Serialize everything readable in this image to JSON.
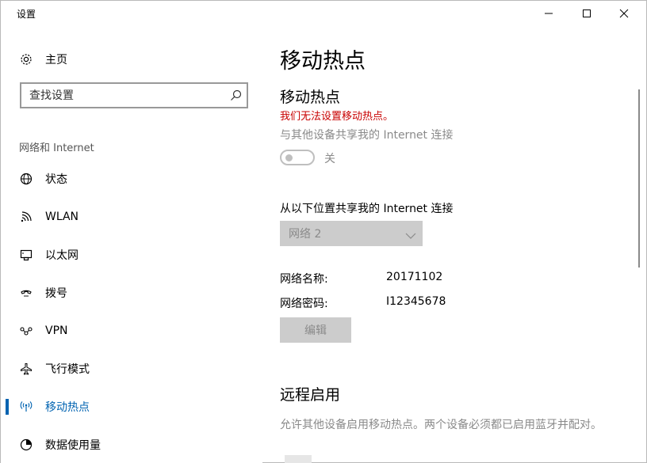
{
  "window": {
    "title": "设置",
    "minimize_label": "Minimize",
    "maximize_label": "Maximize",
    "close_label": "Close"
  },
  "sidebar": {
    "home_label": "主页",
    "search_placeholder": "查找设置",
    "section_label": "网络和 Internet",
    "items": [
      {
        "label": "状态",
        "icon": "globe-icon",
        "active": false
      },
      {
        "label": "WLAN",
        "icon": "wifi-icon",
        "active": false
      },
      {
        "label": "以太网",
        "icon": "ethernet-icon",
        "active": false
      },
      {
        "label": "拨号",
        "icon": "dialup-icon",
        "active": false
      },
      {
        "label": "VPN",
        "icon": "vpn-icon",
        "active": false
      },
      {
        "label": "飞行模式",
        "icon": "airplane-icon",
        "active": false
      },
      {
        "label": "移动热点",
        "icon": "hotspot-icon",
        "active": true
      },
      {
        "label": "数据使用量",
        "icon": "pie-chart-icon",
        "active": false
      }
    ]
  },
  "main": {
    "page_title": "移动热点",
    "section_title": "移动热点",
    "error_text": "我们无法设置移动热点。",
    "share_text": "与其他设备共享我的 Internet 连接",
    "toggle_state": "关",
    "share_from_label": "从以下位置共享我的 Internet 连接",
    "share_from_value": "网络  2",
    "network_name_label": "网络名称:",
    "network_name_value": "20171102",
    "network_password_label": "网络密码:",
    "network_password_value": "I12345678",
    "edit_button": "编辑",
    "remote_title": "远程启用",
    "remote_desc": "允许其他设备启用移动热点。两个设备必须都已启用蓝牙并配对。"
  },
  "colors": {
    "accent": "#0063b1",
    "error": "#c80000",
    "disabled_text": "#8a8a8a",
    "disabled_fill": "#cccccc"
  }
}
